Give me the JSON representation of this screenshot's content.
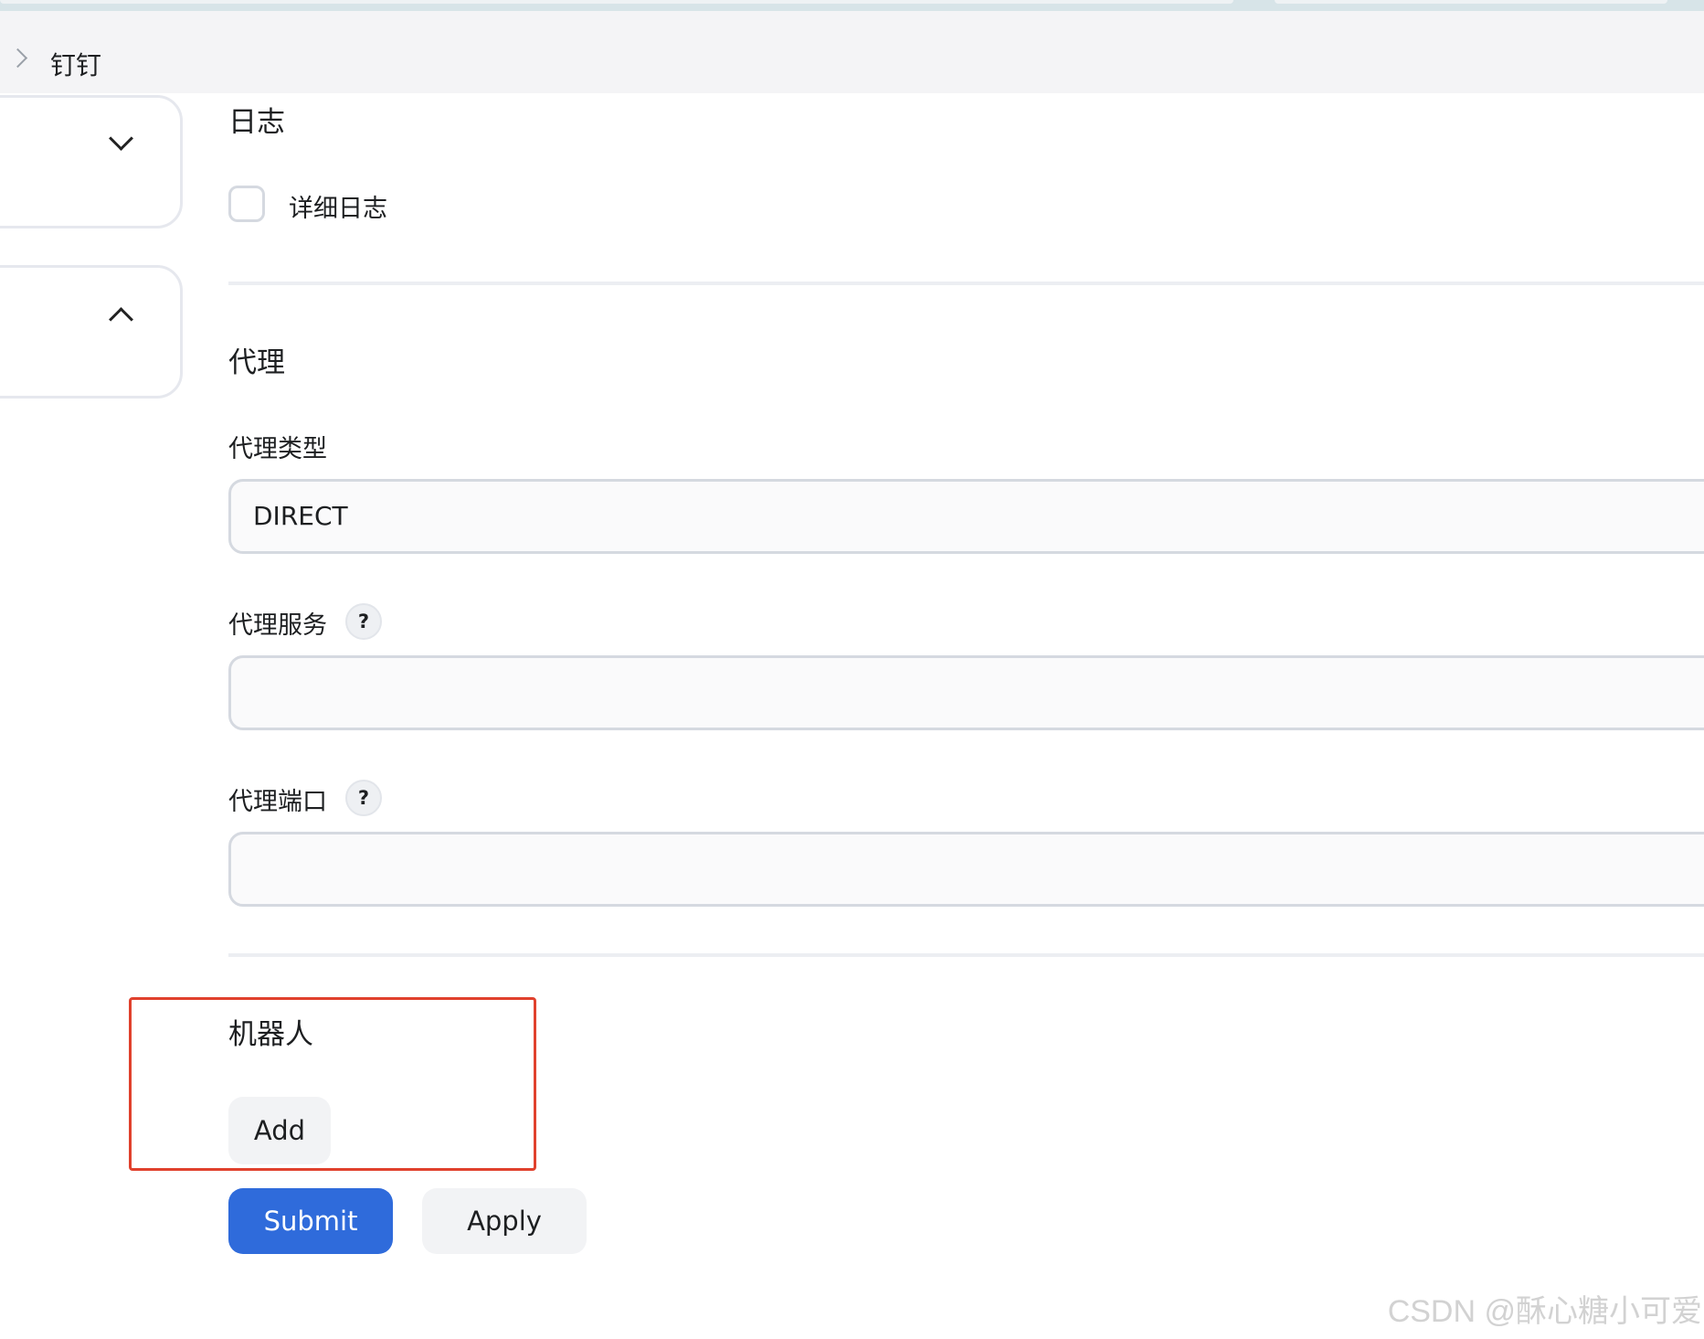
{
  "breadcrumb": {
    "current": "钉钉"
  },
  "log_section": {
    "title": "日志",
    "verbose_label": "详细日志",
    "verbose_checked": false
  },
  "proxy_section": {
    "title": "代理",
    "type_label": "代理类型",
    "type_value": "DIRECT",
    "service_label": "代理服务",
    "service_value": "",
    "port_label": "代理端口",
    "port_value": "",
    "help_text": "?"
  },
  "robot_section": {
    "title": "机器人",
    "add_label": "Add"
  },
  "actions": {
    "submit_label": "Submit",
    "apply_label": "Apply"
  },
  "watermark": "CSDN @酥心糖小可爱",
  "colors": {
    "accent": "#2f6bdb",
    "highlight_border": "#e0412d",
    "breadcrumb_bg": "#f4f4f6"
  }
}
